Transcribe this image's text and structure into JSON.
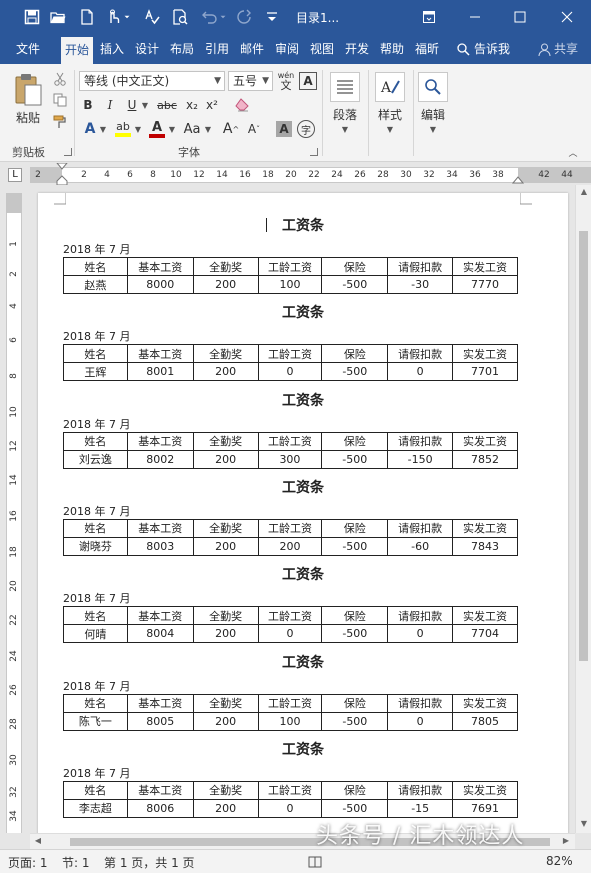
{
  "title_bar": {
    "doc_title": "目录1..."
  },
  "tabs": [
    {
      "label": "文件",
      "active": false
    },
    {
      "label": "开始",
      "active": true
    },
    {
      "label": "插入",
      "active": false
    },
    {
      "label": "设计",
      "active": false
    },
    {
      "label": "布局",
      "active": false
    },
    {
      "label": "引用",
      "active": false
    },
    {
      "label": "邮件",
      "active": false
    },
    {
      "label": "审阅",
      "active": false
    },
    {
      "label": "视图",
      "active": false
    },
    {
      "label": "开发",
      "active": false
    },
    {
      "label": "帮助",
      "active": false
    },
    {
      "label": "福昕",
      "active": false
    }
  ],
  "tell_me": "告诉我",
  "share": "共享",
  "ribbon": {
    "clipboard": {
      "paste_label": "粘贴",
      "group_label": "剪贴板"
    },
    "font": {
      "font_name": "等线 (中文正文)",
      "font_size": "五号",
      "wen_label_top": "wén",
      "wen_label_bottom": "文",
      "char_border_label": "A",
      "bold": "B",
      "italic": "I",
      "underline": "U",
      "strike": "abc",
      "subscript": "x₂",
      "superscript": "x²",
      "text_effect": "A",
      "highlight": "ab",
      "font_color": "A",
      "change_case": "Aa",
      "grow_font": "A",
      "shrink_font": "A",
      "char_shading": "A",
      "enclose_char": "字",
      "group_label": "字体"
    },
    "paragraph": {
      "label": "段落"
    },
    "styles": {
      "label": "样式"
    },
    "editing": {
      "label": "编辑"
    }
  },
  "ruler": {
    "tab_selector": "L",
    "h_ticks": [
      "2",
      "2",
      "4",
      "6",
      "8",
      "10",
      "12",
      "14",
      "16",
      "18",
      "20",
      "22",
      "24",
      "26",
      "28",
      "30",
      "32",
      "34",
      "36",
      "38",
      "42",
      "44"
    ],
    "v_ticks": [
      "1",
      "2",
      "4",
      "6",
      "8",
      "10",
      "12",
      "14",
      "16",
      "18",
      "20",
      "22",
      "24",
      "26",
      "28",
      "30",
      "32",
      "34",
      "36"
    ]
  },
  "document": {
    "slip_title": "工资条",
    "date": "2018 年 7 月",
    "headers": [
      "姓名",
      "基本工资",
      "全勤奖",
      "工龄工资",
      "保险",
      "请假扣款",
      "实发工资"
    ],
    "slips": [
      {
        "name": "赵燕",
        "base": "8000",
        "attendance": "200",
        "seniority": "100",
        "insurance": "-500",
        "leave": "-30",
        "net": "7770"
      },
      {
        "name": "王辉",
        "base": "8001",
        "attendance": "200",
        "seniority": "0",
        "insurance": "-500",
        "leave": "0",
        "net": "7701"
      },
      {
        "name": "刘云逸",
        "base": "8002",
        "attendance": "200",
        "seniority": "300",
        "insurance": "-500",
        "leave": "-150",
        "net": "7852"
      },
      {
        "name": "谢晓芬",
        "base": "8003",
        "attendance": "200",
        "seniority": "200",
        "insurance": "-500",
        "leave": "-60",
        "net": "7843"
      },
      {
        "name": "何晴",
        "base": "8004",
        "attendance": "200",
        "seniority": "0",
        "insurance": "-500",
        "leave": "0",
        "net": "7704"
      },
      {
        "name": "陈飞一",
        "base": "8005",
        "attendance": "200",
        "seniority": "100",
        "insurance": "-500",
        "leave": "0",
        "net": "7805"
      },
      {
        "name": "李志超",
        "base": "8006",
        "attendance": "200",
        "seniority": "0",
        "insurance": "-500",
        "leave": "-15",
        "net": "7691"
      }
    ]
  },
  "status_bar": {
    "page": "页面: 1",
    "section": "节: 1",
    "page_of": "第 1 页，共 1 页",
    "zoom": "82%"
  },
  "watermark": "头条号 / 汇木领达人",
  "colors": {
    "title_bar": "#2b579a",
    "ribbon": "#f3f3f3",
    "font_color_red": "#c00000",
    "highlight_yellow": "#ffff00"
  }
}
